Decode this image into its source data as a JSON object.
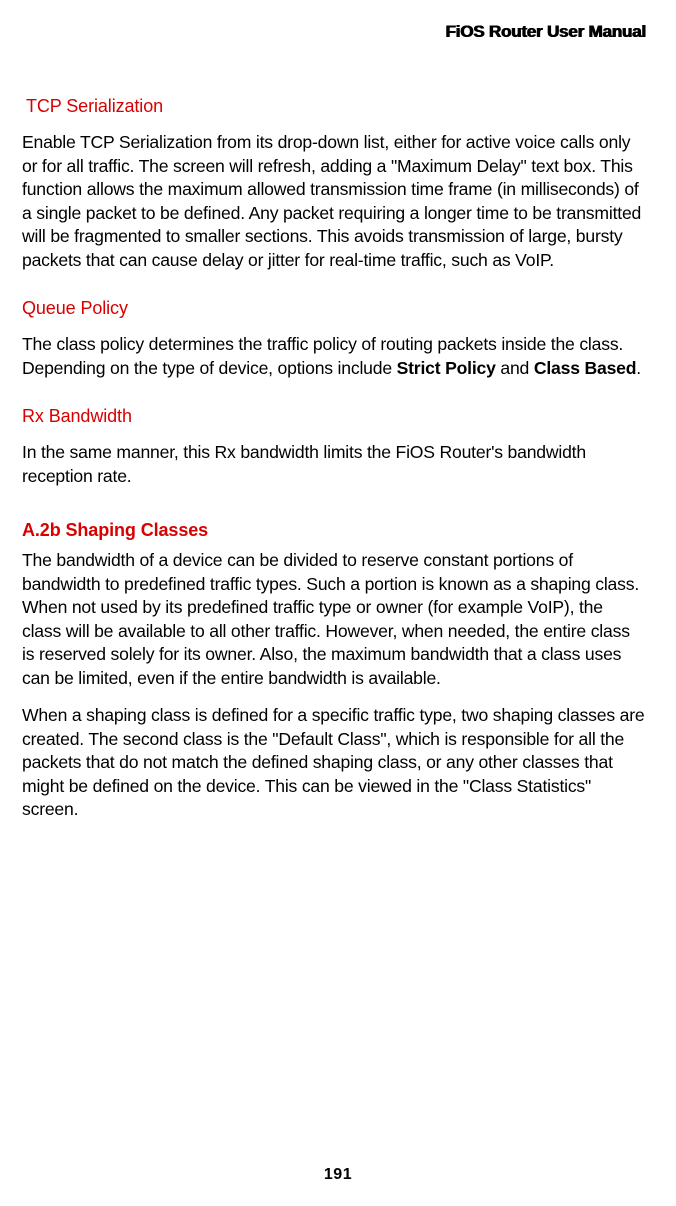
{
  "docTitle": "FiOS Router User Manual",
  "sections": {
    "tcpSerialization": {
      "heading": "TCP Serialization",
      "body": "Enable TCP Serialization from its drop-down list, either for active voice calls only or for all traffic. The screen will refresh, adding a \"Maximum Delay\" text box. This function allows the maximum allowed transmission time frame (in milliseconds) of a single packet to be defined. Any packet requiring a longer time to be transmitted will be fragmented to smaller sections. This avoids transmission of large, bursty packets that can cause delay or jitter for real-time traffic, such as VoIP."
    },
    "queuePolicy": {
      "heading": "Queue Policy",
      "bodyPrefix": "The class policy determines the traffic policy of routing packets inside the class. Depending on the type of device, options include ",
      "term1": "Strict Policy",
      "sep": " and ",
      "term2": "Class Based",
      "bodySuffix": "."
    },
    "rxBandwidth": {
      "heading": "Rx Bandwidth",
      "body": "In the same manner, this Rx bandwidth limits the FiOS Router's bandwidth reception rate."
    },
    "shapingClasses": {
      "heading": "A.2b Shaping Classes",
      "body1": "The bandwidth of a device can be divided to reserve constant portions of bandwidth to predefined traffic types. Such a portion is known as a shaping class. When not used by its predefined traffic type or owner (for example VoIP), the class will be available to all other traffic. However, when needed, the entire class is reserved solely for its owner. Also, the maximum bandwidth that a class uses can be limited, even if the entire bandwidth is available.",
      "body2": "When a shaping class is defined for a specific traffic type, two shaping classes are created. The second class is the \"Default Class\", which is responsible for all the packets that do not match the defined shaping class, or any other classes that might be defined on the device. This can be viewed in the \"Class Statistics\" screen."
    }
  },
  "pageNumber": "191"
}
